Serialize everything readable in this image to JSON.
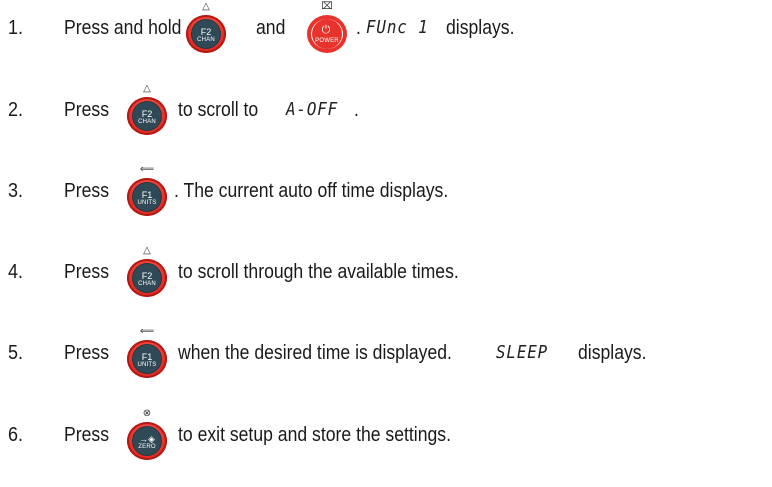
{
  "steps": [
    {
      "number": "1.",
      "parts": {
        "press_hold": "Press and hold",
        "and": "and",
        "display_code": "FUnc 1",
        "tail": "displays."
      },
      "keys": {
        "a": {
          "hint": "△",
          "label": "F2",
          "sub": "CHAN"
        },
        "b": {
          "hint": "⌧",
          "label": "⏻",
          "sub": "POWER"
        }
      }
    },
    {
      "number": "2.",
      "parts": {
        "press": "Press",
        "mid": "to scroll to",
        "display_code": "A-OFF",
        "tail": "."
      },
      "keys": {
        "a": {
          "hint": "△",
          "label": "F2",
          "sub": "CHAN"
        }
      }
    },
    {
      "number": "3.",
      "parts": {
        "press": "Press",
        "tail": ". The current auto off time displays."
      },
      "keys": {
        "a": {
          "hint": "⟸",
          "label": "F1",
          "sub": "UNITS"
        }
      }
    },
    {
      "number": "4.",
      "parts": {
        "press": "Press",
        "tail": "to scroll through the available times."
      },
      "keys": {
        "a": {
          "hint": "△",
          "label": "F2",
          "sub": "CHAN"
        }
      }
    },
    {
      "number": "5.",
      "parts": {
        "press": "Press",
        "mid": "when the desired time is displayed.",
        "display_code": "SLEEP",
        "tail": "displays."
      },
      "keys": {
        "a": {
          "hint": "⟸",
          "label": "F1",
          "sub": "UNITS"
        }
      }
    },
    {
      "number": "6.",
      "parts": {
        "press": "Press",
        "tail": "to exit setup and store the settings."
      },
      "keys": {
        "a": {
          "hint": "⊗",
          "label": "→◈",
          "sub": "ZERO"
        }
      }
    }
  ],
  "colors": {
    "key_ring": "#e8332c",
    "key_center": "#2f4a56",
    "text": "#1a1a1a"
  },
  "icons": {
    "chan_key_hint": "triangle-up-icon",
    "power_key_hint": "cross-box-icon",
    "units_key_hint": "enter-arrow-icon",
    "zero_key_hint": "circle-s-icon",
    "power_symbol": "power-icon",
    "zero_symbol": "zero-target-icon"
  }
}
